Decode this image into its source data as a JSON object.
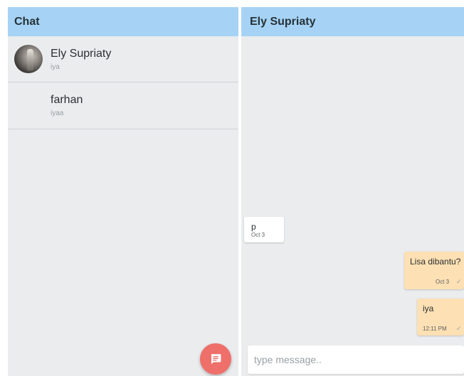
{
  "left_panel": {
    "title": "Chat",
    "chats": [
      {
        "name": "Ely Supriaty",
        "preview": "iya",
        "has_avatar": true
      },
      {
        "name": "farhan",
        "preview": "iyaa",
        "has_avatar": false
      }
    ],
    "fab_icon": "message-icon"
  },
  "right_panel": {
    "title": "Ely Supriaty",
    "messages": [
      {
        "direction": "incoming",
        "text": "p",
        "time": "Oct 3"
      },
      {
        "direction": "outgoing",
        "text": "Lisa dibantu?",
        "time": "Oct 3",
        "status_icon": "check-icon"
      },
      {
        "direction": "outgoing",
        "text": "iya",
        "time": "12:11 PM",
        "status_icon": "check-icon"
      }
    ],
    "input": {
      "placeholder": "type message..",
      "value": ""
    }
  },
  "colors": {
    "header": "#a6d3f5",
    "background": "#eaecee",
    "outgoing_bubble": "#fde0b3",
    "incoming_bubble": "#ffffff",
    "fab": "#ef6f6a"
  }
}
